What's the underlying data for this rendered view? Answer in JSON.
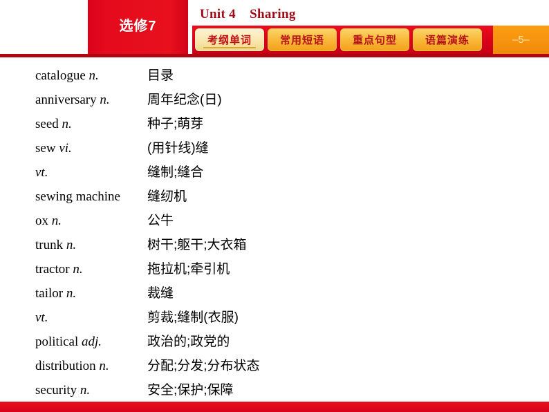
{
  "header": {
    "book_label": "选修7",
    "unit_title": "Unit 4    Sharing",
    "page_number": "–5–",
    "tabs": [
      {
        "label": "考纲单词",
        "active": true
      },
      {
        "label": "常用短语",
        "active": false
      },
      {
        "label": "重点句型",
        "active": false
      },
      {
        "label": "语篇演练",
        "active": false
      }
    ],
    "colors": {
      "brand_red": "#e00a1a",
      "dark_red": "#b1050f",
      "title_red": "#9e0b16",
      "tab_active_bg": "#f9e7ae",
      "tab_inactive_bg": "#f9bb3d",
      "page_block_orange": "#f7920f"
    }
  },
  "wordlist": [
    {
      "word": "catalogue",
      "pos": "n.",
      "meaning": "目录"
    },
    {
      "word": "anniversary",
      "pos": "n.",
      "meaning": "周年纪念(日)"
    },
    {
      "word": "seed",
      "pos": "n.",
      "meaning": "种子;萌芽"
    },
    {
      "word": "sew",
      "pos": "vi.",
      "meaning": "(用针线)缝"
    },
    {
      "word": "",
      "pos": "vt.",
      "meaning": "缝制;缝合"
    },
    {
      "word": "sewing machine",
      "pos": "",
      "meaning": "缝纫机"
    },
    {
      "word": "ox",
      "pos": "n.",
      "meaning": "公牛"
    },
    {
      "word": "trunk",
      "pos": "n.",
      "meaning": "树干;躯干;大衣箱"
    },
    {
      "word": "tractor",
      "pos": "n.",
      "meaning": "拖拉机;牵引机"
    },
    {
      "word": "tailor",
      "pos": "n.",
      "meaning": "裁缝"
    },
    {
      "word": "",
      "pos": "vt.",
      "meaning": "剪裁;缝制(衣服)"
    },
    {
      "word": "political",
      "pos": "adj.",
      "meaning": "政治的;政党的"
    },
    {
      "word": "distribution",
      "pos": "n.",
      "meaning": "分配;分发;分布状态"
    },
    {
      "word": "security",
      "pos": "n.",
      "meaning": "安全;保护;保障"
    }
  ]
}
